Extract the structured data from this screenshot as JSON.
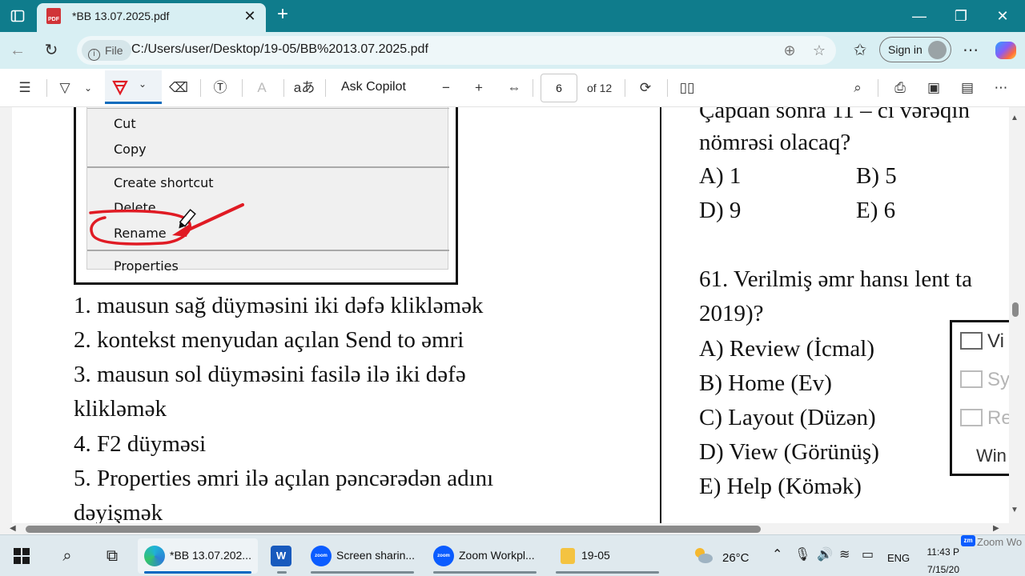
{
  "browser": {
    "tab_title": "*BB 13.07.2025.pdf",
    "tab_icon_text": "PDF",
    "file_chip": "File",
    "url": "C:/Users/user/Desktop/19-05/BB%2013.07.2025.pdf",
    "signin_label": "Sign in"
  },
  "pdf_toolbar": {
    "ask_copilot": "Ask Copilot",
    "page_number": "6",
    "page_total": "of 12"
  },
  "context_menu": {
    "items": [
      "Cut",
      "Copy",
      "Create shortcut",
      "Delete",
      "Rename",
      "Properties"
    ]
  },
  "left_column": {
    "lines": [
      "1. mausun sağ düyməsini iki dəfə kliklәmәk",
      "2. kontekst menyudan açılan Send to əmri",
      "3. mausun sol düyməsini fasilə ilə iki dəfə",
      "kliklәmәk",
      "4. F2 düyməsi",
      "5. Properties əmri ilə açılan pəncərədən adını",
      "dəyişmək"
    ]
  },
  "right_column": {
    "prev_question_tail": [
      "Çapdan sonra 11 – ci vərəqin",
      "nömrəsi olacaq?"
    ],
    "prev_options": [
      "A) 1",
      "B) 5",
      "D) 9",
      "E) 6"
    ],
    "question": [
      "61. Verilmiş əmr hansı lent ta",
      "2019)?"
    ],
    "options": [
      "A) Review (İcmal)",
      "B) Home (Ev)",
      "C) Layout (Düzən)",
      "D) View (Görünüş)",
      "E) Help (Kömək)"
    ]
  },
  "ribbon_snippet": {
    "items": [
      "Vi",
      "Sy",
      "Re",
      "Win"
    ]
  },
  "taskbar": {
    "apps": [
      {
        "label": "*BB 13.07.202..."
      },
      {
        "label": "Screen sharin..."
      },
      {
        "label": "Zoom Workpl..."
      },
      {
        "label": "19-05"
      }
    ],
    "zoom_icon_text": "zoom",
    "word_icon_text": "W",
    "temperature": "26°C",
    "language": "ENG",
    "time": "11:43 P",
    "date": "7/15/20",
    "zoom_notification_badge": "zm",
    "zoom_notification": "Zoom Wo"
  },
  "colors": {
    "titlebar": "#0f7c8c",
    "addressbar": "#d8eff3",
    "annotation_red": "#e01b24",
    "accent_blue": "#0f6cbd"
  }
}
